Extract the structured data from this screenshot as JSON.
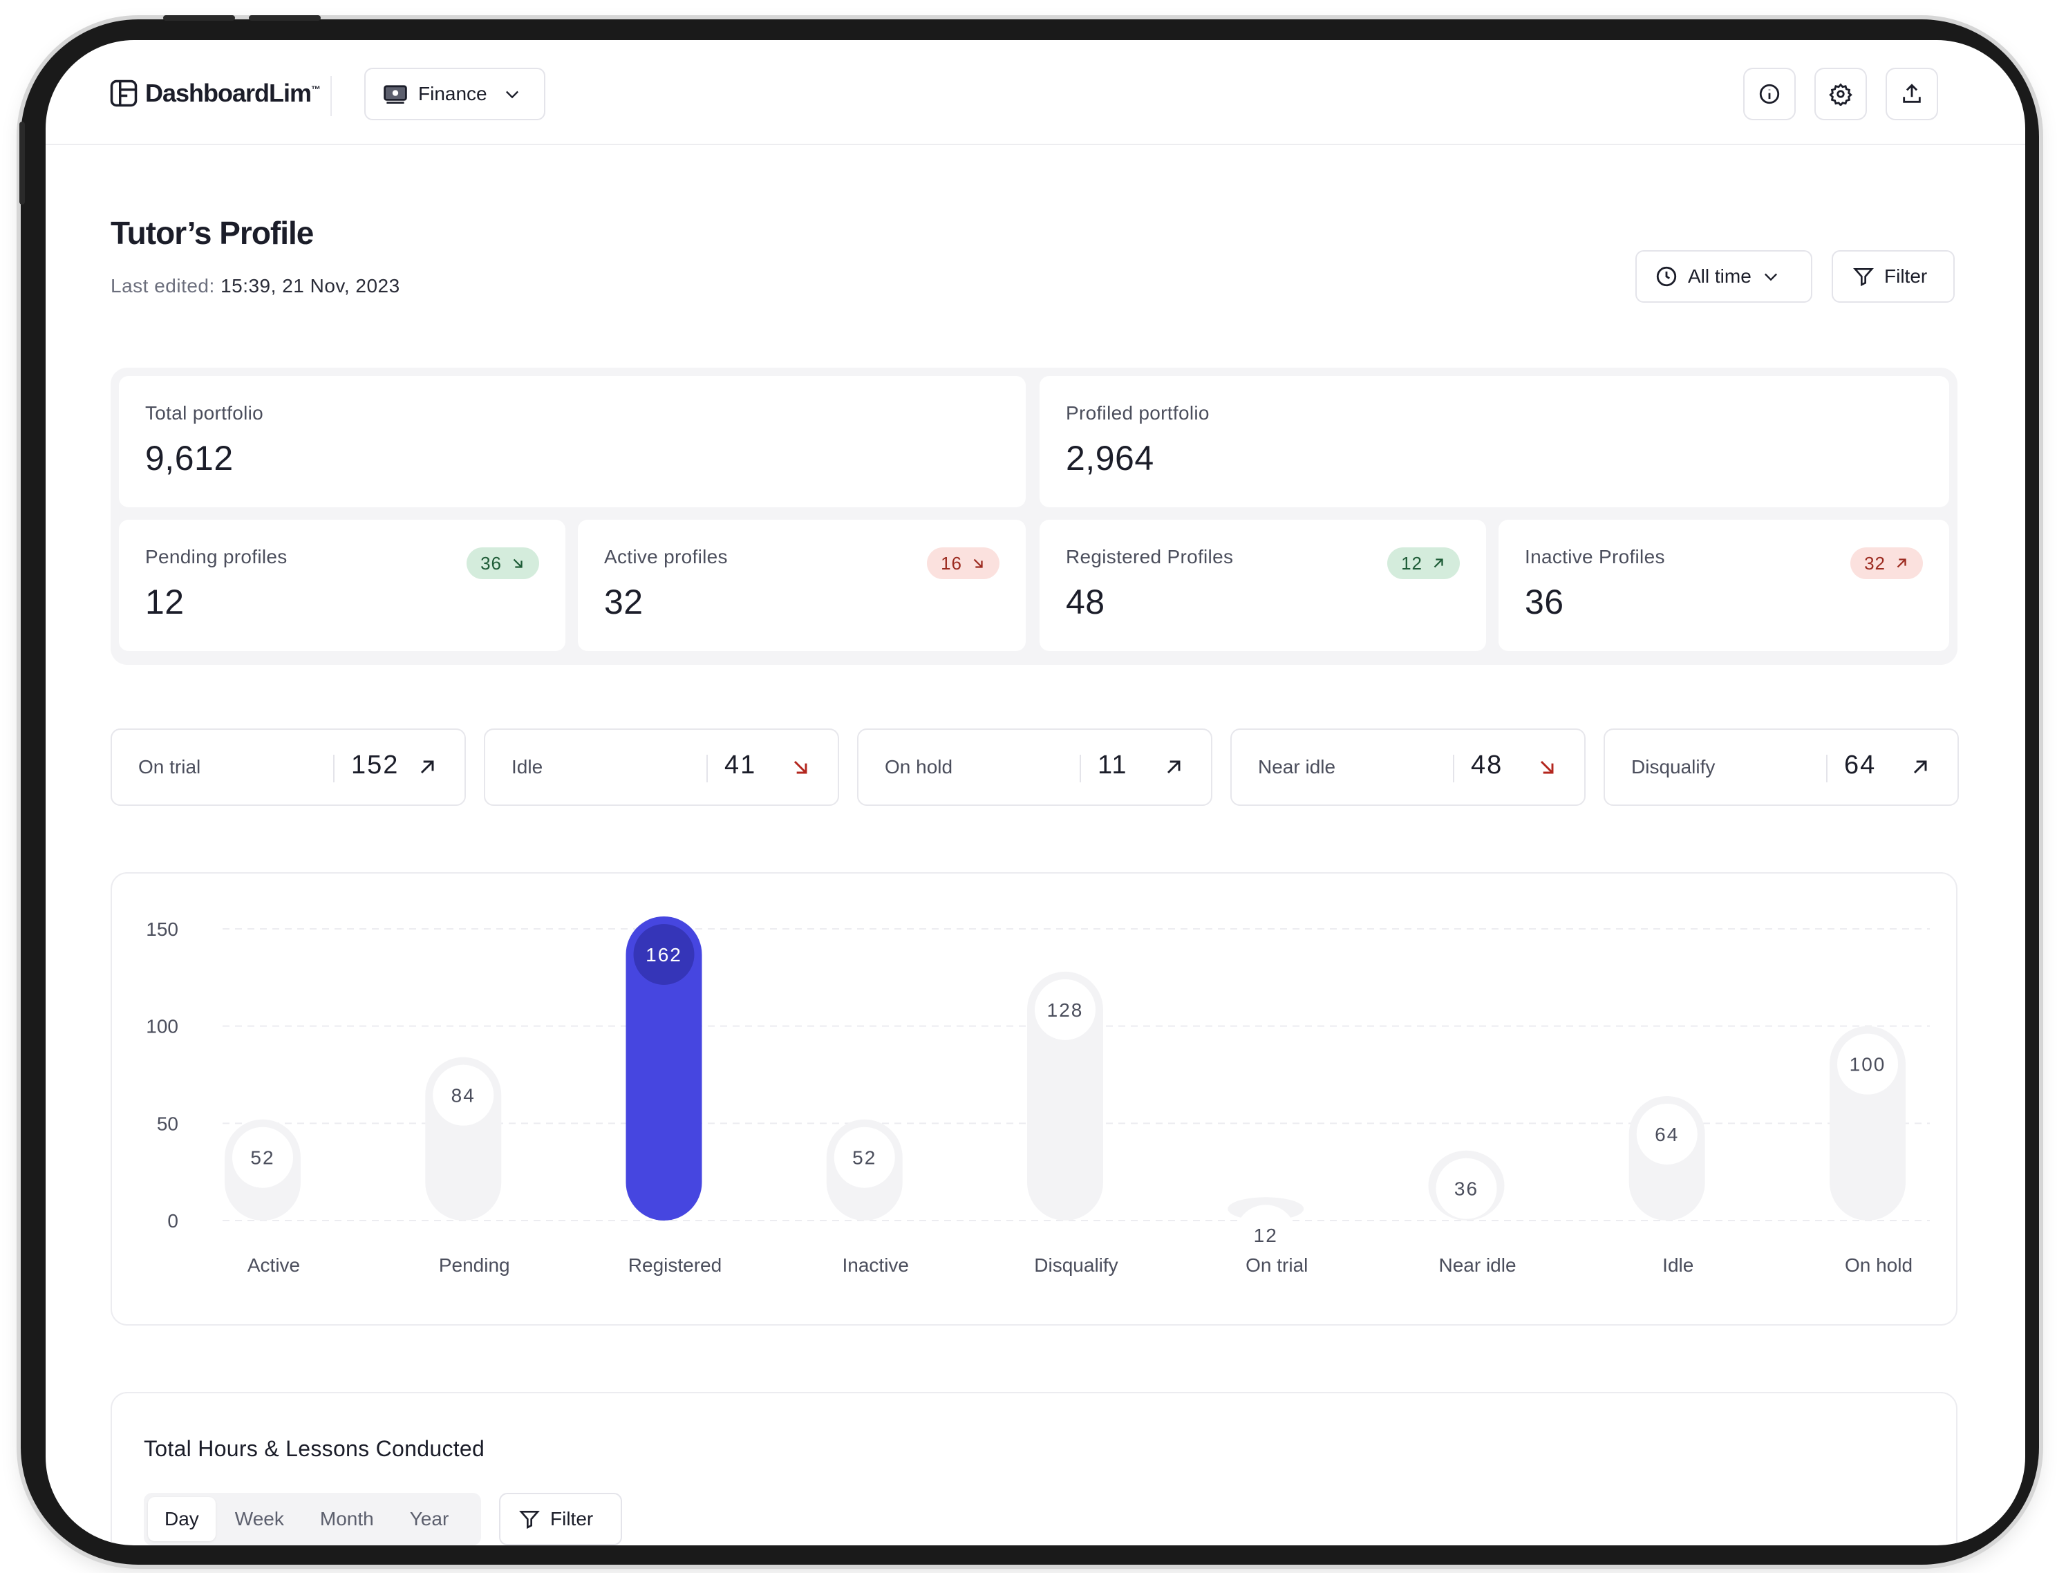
{
  "app": {
    "brand": "DashboardLim",
    "brand_tm": "™"
  },
  "header": {
    "workspace_label": "Finance"
  },
  "page": {
    "title": "Tutor’s Profile",
    "edited_label": "Last edited:",
    "edited_value": "15:39, 21 Nov, 2023",
    "time_filter_label": "All time",
    "filter_label": "Filter"
  },
  "summary": {
    "total": {
      "label": "Total portfolio",
      "value": "9,612"
    },
    "profiled": {
      "label": "Profiled portfolio",
      "value": "2,964"
    },
    "cards": [
      {
        "label": "Pending profiles",
        "value": "12",
        "badge": "36",
        "trend": "down",
        "tone": "green"
      },
      {
        "label": "Active profiles",
        "value": "32",
        "badge": "16",
        "trend": "down",
        "tone": "red"
      },
      {
        "label": "Registered Profiles",
        "value": "48",
        "badge": "12",
        "trend": "up",
        "tone": "green"
      },
      {
        "label": "Inactive Profiles",
        "value": "36",
        "badge": "32",
        "trend": "up",
        "tone": "red"
      }
    ]
  },
  "metrics": [
    {
      "label": "On trial",
      "value": "152",
      "trend": "up",
      "color": "#1b1d29"
    },
    {
      "label": "Idle",
      "value": "41",
      "trend": "down",
      "color": "#b3261e"
    },
    {
      "label": "On hold",
      "value": "11",
      "trend": "up",
      "color": "#1b1d29"
    },
    {
      "label": "Near idle",
      "value": "48",
      "trend": "down",
      "color": "#b3261e"
    },
    {
      "label": "Disqualify",
      "value": "64",
      "trend": "up",
      "color": "#1b1d29"
    }
  ],
  "chart_data": {
    "type": "bar",
    "categories": [
      "Active",
      "Pending",
      "Registered",
      "Inactive",
      "Disqualify",
      "On trial",
      "Near idle",
      "Idle",
      "On hold"
    ],
    "values": [
      52,
      84,
      162,
      52,
      128,
      12,
      36,
      64,
      100
    ],
    "highlight_index": 2,
    "yticks": [
      0,
      50,
      100,
      150
    ],
    "ylim": [
      0,
      162
    ],
    "grid": true,
    "colors": {
      "highlight": "#4646e0",
      "highlight_badge": "#3535b8",
      "bar": "#f3f3f5",
      "text": "#4b4e5c"
    }
  },
  "bottom": {
    "title": "Total Hours & Lessons Conducted",
    "tabs": [
      "Day",
      "Week",
      "Month",
      "Year"
    ],
    "active_tab": "Day",
    "filter_label": "Filter"
  }
}
